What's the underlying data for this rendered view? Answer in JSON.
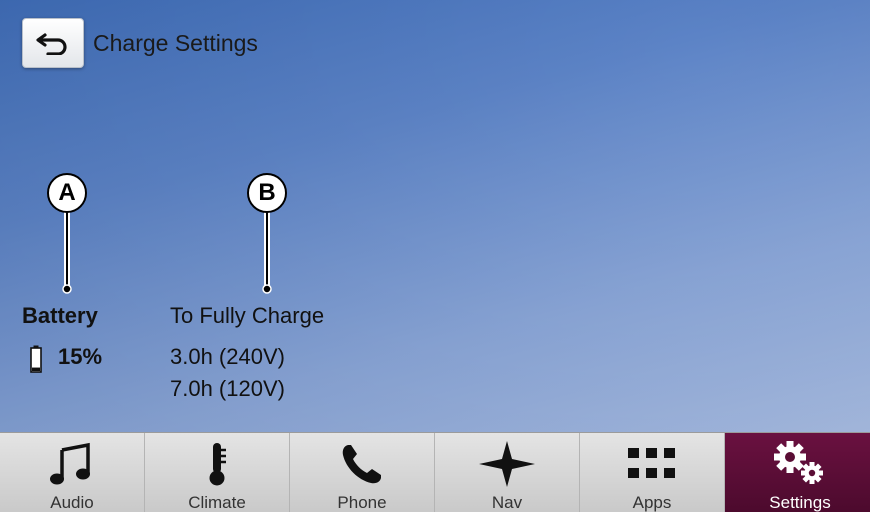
{
  "header": {
    "back_icon": "back-arrow-icon",
    "title": "Charge Settings"
  },
  "callouts": {
    "a": "A",
    "b": "B"
  },
  "battery": {
    "heading": "Battery",
    "icon": "battery-icon",
    "level": "15%",
    "level_fraction": 0.15
  },
  "charge": {
    "heading": "To Fully Charge",
    "time_240v": "3.0h (240V)",
    "time_120v": "7.0h (120V)"
  },
  "dock": {
    "items": [
      {
        "label": "Audio",
        "icon": "music-note-icon"
      },
      {
        "label": "Climate",
        "icon": "thermometer-icon"
      },
      {
        "label": "Phone",
        "icon": "phone-icon"
      },
      {
        "label": "Nav",
        "icon": "compass-star-icon"
      },
      {
        "label": "Apps",
        "icon": "apps-grid-icon"
      },
      {
        "label": "Settings",
        "icon": "gears-icon"
      }
    ],
    "active": "Settings"
  },
  "colors": {
    "background_top": "#3f6db8",
    "background_bottom": "#b4c6e8",
    "active_tab": "#5a0d35",
    "dock": "#d6d6d6"
  }
}
